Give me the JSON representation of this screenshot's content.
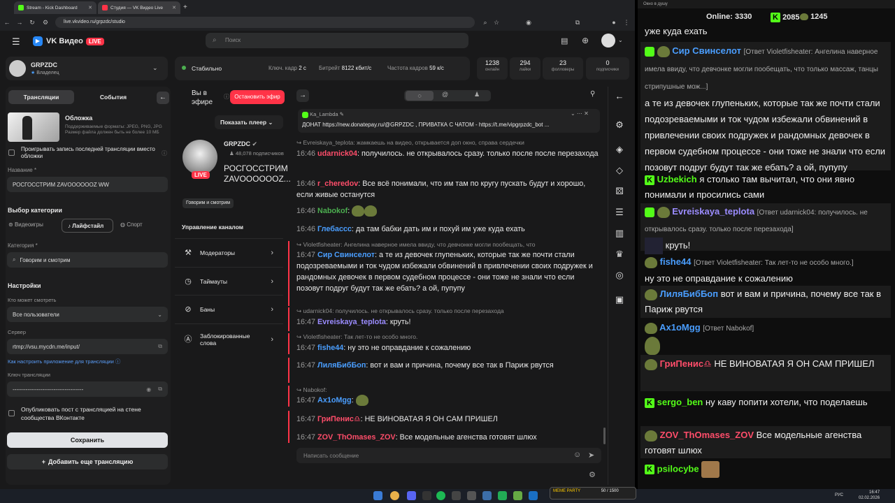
{
  "browser": {
    "tabs": [
      {
        "title": "Stream - Kick Dashboard",
        "fav": "#53fc18"
      },
      {
        "title": "Студия — VK Видео Live",
        "fav": "#ff3347"
      }
    ],
    "url": "live.vkvideo.ru/grpzdc/studio",
    "popup_title": "Окно в душу"
  },
  "header": {
    "brand": "VK Видео",
    "live": "LIVE",
    "search_placeholder": "Поиск"
  },
  "channel": {
    "name": "GRPZDC",
    "role": "Владелец"
  },
  "status": {
    "label": "Стабильно",
    "keyframe_label": "Ключ. кадр",
    "keyframe": "2 с",
    "bitrate_label": "Битрейт",
    "bitrate": "8122 кбит/с",
    "fps_label": "Частота кадров",
    "fps": "59 к/с"
  },
  "stats": [
    {
      "n": "1238",
      "l": "онлайн"
    },
    {
      "n": "294",
      "l": "лайки"
    },
    {
      "n": "23",
      "l": "фолловеры"
    },
    {
      "n": "0",
      "l": "подписчики"
    }
  ],
  "left": {
    "tab_streams": "Трансляции",
    "tab_events": "События",
    "cover_title": "Обложка",
    "cover_desc": "Поддерживаемые форматы: JPEG, PNG, JPG Размер файла должен быть не более 10 МБ",
    "replay_label": "Проигрывать запись последней трансляции вместо обложки",
    "name_label": "Название *",
    "name_value": "РОСГОССТРИМ ZAVOOOOOOZ WW",
    "cat_choice": "Выбор категории",
    "cat_games": "Видеоигры",
    "cat_life": "Лайфстайл",
    "cat_sport": "Спорт",
    "category_label": "Категория *",
    "category_value": "Говорим и смотрим",
    "settings": "Настройки",
    "who_label": "Кто может смотреть",
    "who_value": "Все пользователи",
    "server_label": "Сервер",
    "server_value": "rtmp://vsu.mycdn.me/input/",
    "howto": "Как настроить приложение для трансляции",
    "key_label": "Ключ трансляции",
    "key_value": "--------------------------------------",
    "publish": "Опубликовать пост с трансляцией на стене сообщества ВКонтакте",
    "save": "Сохранить",
    "add": "Добавить еще трансляцию"
  },
  "middle": {
    "on_air": "Вы в эфире",
    "stop": "Остановить эфир",
    "show_player": "Показать плеер",
    "ch_name": "GRPZDC",
    "subs": "48,078 подписчиков",
    "stream_title": "РОСГОССТРИМ ZAVOOOOOOZ...",
    "badge": "Говорим и смотрим",
    "manage": "Управление каналом",
    "menu": [
      "Модераторы",
      "Таймауты",
      "Баны",
      "Заблокированные слова"
    ]
  },
  "pinned": {
    "user": "Ka_Lambda",
    "text": "ДОНАТ https://new.donatepay.ru/@GRPZDC , ПРИВАТКА С ЧАТОМ - https://t.me/vipgrpzdc_bot ..."
  },
  "chat": [
    {
      "reply": "Evreiskaya_teplota: жамкаешь на видео, открывается доп окно, справа сердечки"
    },
    {
      "time": "16:46",
      "user": "udarnick04",
      "color": "#ff4d6a",
      "text": "получилось. не открывалось сразу. только после после перезахода"
    },
    {
      "time": "16:46",
      "user": "r_cheredov",
      "color": "#ff4d6a",
      "text": "Все всё понимали, что им там по кругу пускать будут и хорошо, если живые останутся"
    },
    {
      "time": "16:46",
      "user": "Nabokof",
      "color": "#4caf50",
      "text": ""
    },
    {
      "time": "16:46",
      "user": "Глебасcс",
      "color": "#4a9eff",
      "text": "да там бабки дать им и похуй им уже куда ехать"
    },
    {
      "reply": "Violetfisheater: Ангелина наверное имела ввиду, что девчонке могли пообещать, что"
    },
    {
      "time": "16:47",
      "user": "Сир Свинселот",
      "color": "#4a9eff",
      "text": "а те из девочек глупеньких, которые так же почти стали подозреваемыми и ток чудом избежали обвинений в привлечении своих подружек и рандомных девочек в первом судебном процессе - они тоже не знали что если позовут подруг будут так же ебать? а ой, пупупу"
    },
    {
      "reply": "udarnick04: получилось. не открывалось сразу. только после перезахода"
    },
    {
      "time": "16:47",
      "user": "Evreiskaya_teplota",
      "color": "#9b8cff",
      "text": "круть!"
    },
    {
      "reply": "Violetfisheater: Так лет-то не особо много."
    },
    {
      "time": "16:47",
      "user": "fishe44",
      "color": "#4a9eff",
      "text": "ну это не оправдание к сожалению"
    },
    {
      "time": "16:47",
      "user": "ЛиляБибБоп",
      "color": "#4a9eff",
      "text": "вот и вам и причина, почему все так в Париж рвутся"
    },
    {
      "reply": "Nabokof:"
    },
    {
      "time": "16:47",
      "user": "Ax1oMgg",
      "color": "#4a9eff",
      "text": ""
    },
    {
      "time": "16:47",
      "user": "ГриПенис♎",
      "color": "#ff4d6a",
      "text": "НЕ ВИНОВАТАЯ Я ОН САМ ПРИШЕЛ"
    },
    {
      "time": "16:47",
      "user": "ZOV_ThOmases_ZOV",
      "color": "#ff4d6a",
      "text": "Все модельные агенства готовят шлюх"
    }
  ],
  "chat_input": "Написать сообщение",
  "right": {
    "online_label": "Online:",
    "online": "3330",
    "kick_count": "2085",
    "vk_count": "1245",
    "messages": [
      {
        "user": "",
        "text": "уже куда ехать"
      },
      {
        "user": "Сир Свинселот",
        "color": "#4a9eff",
        "reply": "[Ответ Violetfisheater: Ангелина наверное имела ввиду, что девчонке могли пообещать, что только массаж, танцы стрипушные мож...]",
        "text": "а те из девочек глупеньких, которые так же почти стали подозреваемыми и ток чудом избежали обвинений в привлечении своих подружек и рандомных девочек в первом судебном процессе - они тоже не знали что если позовут подруг будут так же ебать? а ой, пупупу"
      },
      {
        "user": "Uzbekich",
        "color": "#53fc18",
        "text": "я столько там вычитал, что они явно понимали и просились сами"
      },
      {
        "user": "Evreiskaya_teplota",
        "color": "#9b8cff",
        "reply": "[Ответ udarnick04: получилось. не открывалось сразу. только после перезахода]",
        "text": "круть!"
      },
      {
        "user": "fishe44",
        "color": "#4a9eff",
        "reply": "[Ответ Violetfisheater: Так лет-то не особо много.]",
        "text": "ну это не оправдание к сожалению"
      },
      {
        "user": "ЛиляБибБоп",
        "color": "#4a9eff",
        "text": "вот и вам и причина, почему все так в Париж рвутся"
      },
      {
        "user": "Ax1oMgg",
        "color": "#4a9eff",
        "reply": "[Ответ Nabokof]",
        "text": ""
      },
      {
        "user": "ГриПенис♎",
        "color": "#ff4d6a",
        "text": "НЕ ВИНОВАТАЯ Я ОН САМ ПРИШЕЛ"
      },
      {
        "user": "sergo_ben",
        "color": "#53fc18",
        "text": "ну каву попити хотели, что поделаешь"
      },
      {
        "user": "ZOV_ThOmases_ZOV",
        "color": "#ff4d6a",
        "text": "Все модельные агенства готовят шлюх"
      },
      {
        "user": "psilocybe",
        "color": "#53fc18",
        "text": ""
      }
    ]
  },
  "taskbar": {
    "time": "16:47",
    "date": "02.02.2026",
    "lang": "РУС",
    "meme": "MEME PARTY",
    "meme_count": "50 / 1500"
  }
}
